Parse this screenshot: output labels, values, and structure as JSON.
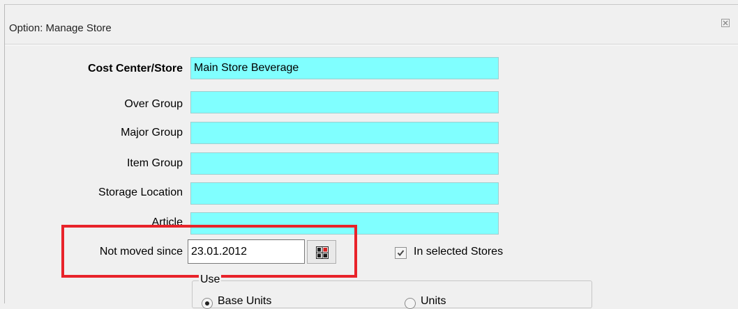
{
  "dialog": {
    "title": "Option: Manage Store",
    "close_icon": "close-icon"
  },
  "form": {
    "cost_center": {
      "label": "Cost Center/Store",
      "value": "Main Store Beverage"
    },
    "over_group": {
      "label": "Over Group",
      "value": ""
    },
    "major_group": {
      "label": "Major Group",
      "value": ""
    },
    "item_group": {
      "label": "Item Group",
      "value": ""
    },
    "storage_location": {
      "label": "Storage Location",
      "value": ""
    },
    "article": {
      "label": "Article",
      "value": ""
    },
    "not_moved_since": {
      "label": "Not moved since",
      "value": "23.01.2012",
      "picker_icon": "calendar-icon"
    },
    "in_selected_stores": {
      "label": "In selected Stores",
      "checked": true
    }
  },
  "use_group": {
    "label": "Use",
    "options": [
      {
        "label": "Base Units",
        "selected": true
      },
      {
        "label": "Units",
        "selected": false
      }
    ]
  },
  "colors": {
    "field_background": "#80ffff",
    "highlight_border": "#e8232a",
    "dialog_background": "#f0f0f0"
  }
}
